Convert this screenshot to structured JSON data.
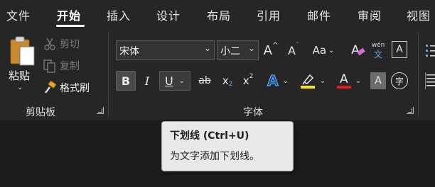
{
  "tabs": [
    {
      "label": "文件"
    },
    {
      "label": "开始"
    },
    {
      "label": "插入"
    },
    {
      "label": "设计"
    },
    {
      "label": "布局"
    },
    {
      "label": "引用"
    },
    {
      "label": "邮件"
    },
    {
      "label": "审阅"
    },
    {
      "label": "视图"
    }
  ],
  "active_tab": "开始",
  "clipboard": {
    "paste_label": "粘贴",
    "cut_label": "剪切",
    "copy_label": "复制",
    "format_painter_label": "格式刷",
    "group_label": "剪贴板"
  },
  "font": {
    "font_name": "宋体",
    "font_size": "小二",
    "grow_label": "A",
    "shrink_label": "A",
    "case_label": "Aa",
    "pinyin_top": "wén",
    "pinyin_bottom": "文",
    "border_label": "A",
    "bold_label": "B",
    "italic_label": "I",
    "underline_label": "U",
    "strike_label": "ab",
    "subscript_label": "x",
    "subscript_sub": "2",
    "superscript_label": "x",
    "superscript_sup": "2",
    "effects_label": "A",
    "font_color_label": "A",
    "shading_label": "A",
    "enclosed_label": "字",
    "group_label": "字体"
  },
  "tooltip": {
    "title": "下划线 (Ctrl+U)",
    "description": "为文字添加下划线。"
  },
  "colors": {
    "highlight": "#f5e900",
    "font_color": "#e31c1c",
    "effects": "#3a8fe0"
  }
}
